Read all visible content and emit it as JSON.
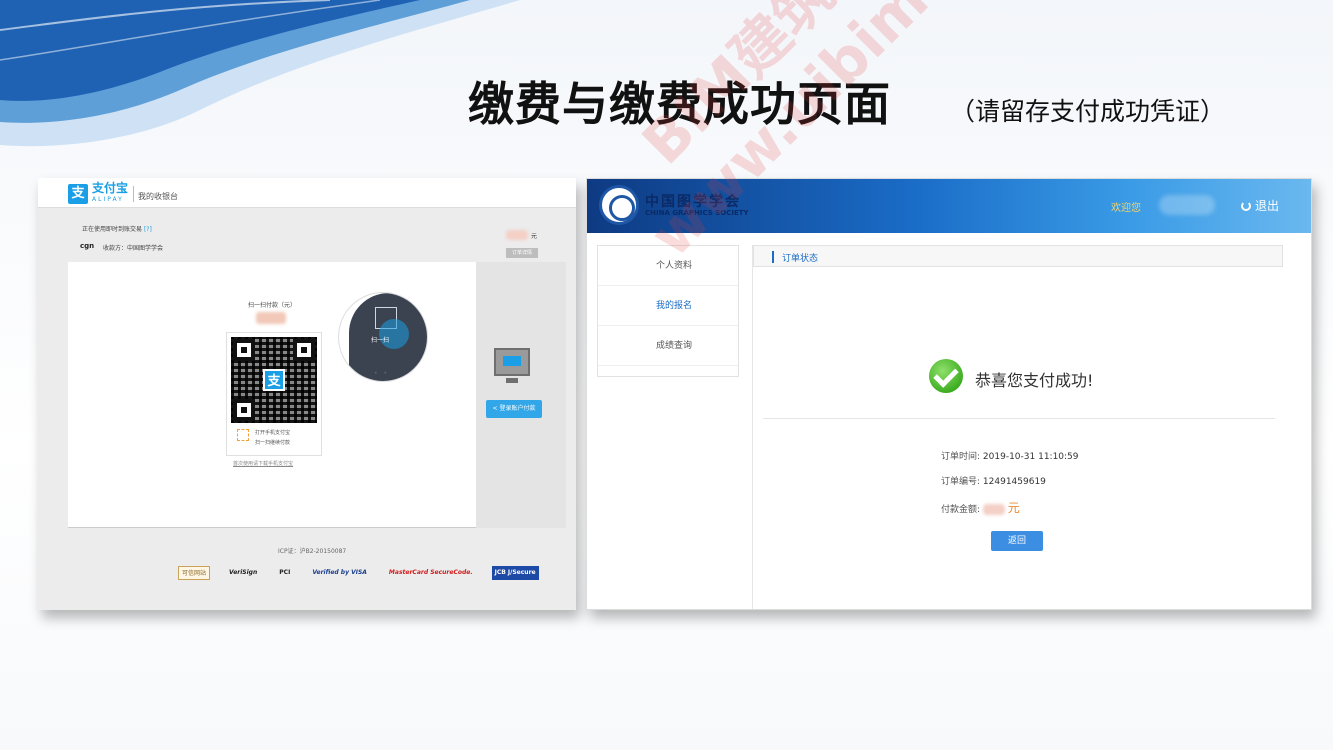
{
  "slide": {
    "title": "缴费与缴费成功页面",
    "subtitle": "（请留存支付成功凭证）"
  },
  "alipay": {
    "logo_glyph": "支",
    "brand": "支付宝",
    "brand_en": "ALIPAY",
    "cashier": "我的收银台",
    "notice": "正在使用即时到账交易",
    "notice_help": "[?]",
    "payer": "cgn",
    "payee": "收款方：中国图学学会",
    "amount_unit": "元",
    "detail_button": "订单详情",
    "scan_label": "扫一扫付款（元）",
    "qr_center_glyph": "支",
    "step1": "打开手机支付宝",
    "step2": "扫一扫继续付款",
    "download_link": "首次使用请下载手机支付宝",
    "phone_label": "扫一扫",
    "phone_dots": "• •",
    "account_button": "< 登录账户付款",
    "icp": "ICP证：沪B2-20150087",
    "badges": [
      "可信网站",
      "VeriSign",
      "PCI",
      "Verified by VISA",
      "MasterCard SecureCode.",
      "JCB J/Secure"
    ]
  },
  "cgs": {
    "name": "中国图学学会",
    "name_en": "CHINA GRAPHICS SOCIETY",
    "welcome": "欢迎您",
    "logout": "退出",
    "menu": [
      "个人资料",
      "我的报名",
      "成绩查询"
    ],
    "section_title": "订单状态",
    "success_message": "恭喜您支付成功!",
    "order_time_label": "订单时间:",
    "order_time": "2019-10-31 11:10:59",
    "order_no_label": "订单编号:",
    "order_no": "12491459619",
    "amount_label": "付款金额:",
    "amount_unit": "元",
    "back_button": "返回"
  },
  "watermark": {
    "line1": "BIM建筑网",
    "line2": "www.uibim.com"
  },
  "colors": {
    "alipay_blue": "#1a9ee5",
    "cgs_blue": "#1a6cc7",
    "success_green": "#3fae22",
    "watermark_red": "#e23c3c"
  }
}
